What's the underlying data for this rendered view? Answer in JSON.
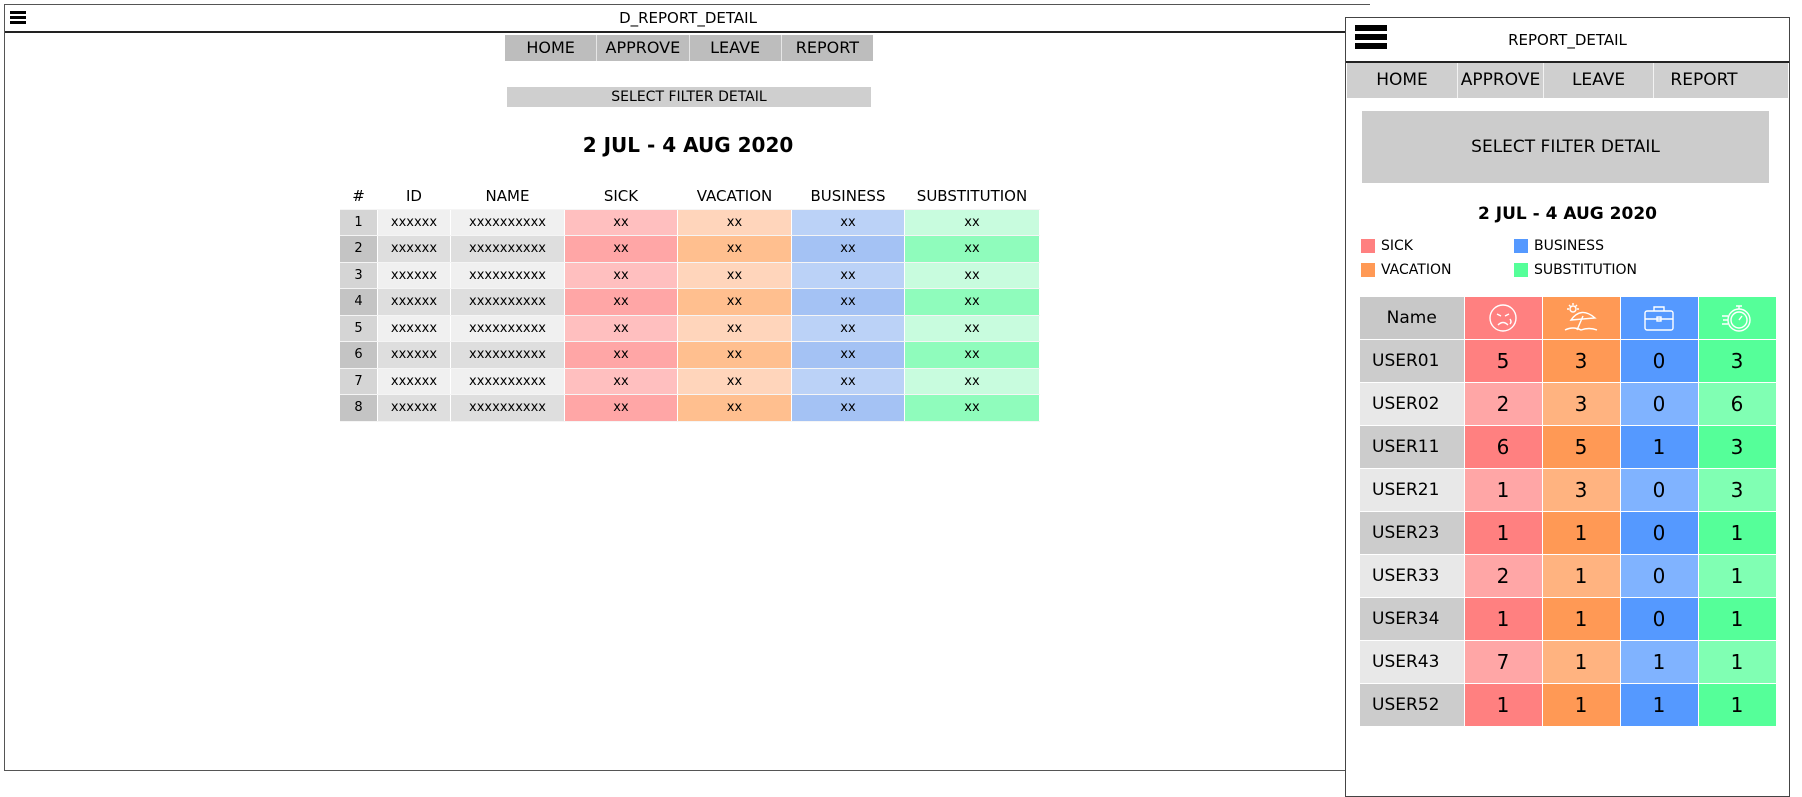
{
  "desktop": {
    "title": "D_REPORT_DETAIL",
    "nav": [
      "HOME",
      "APPROVE",
      "LEAVE",
      "REPORT"
    ],
    "filter_label": "SELECT FILTER DETAIL",
    "date_range": "2 JUL - 4 AUG 2020",
    "table": {
      "headers": [
        "#",
        "ID",
        "NAME",
        "SICK",
        "VACATION",
        "BUSINESS",
        "SUBSTITUTION"
      ],
      "rows": [
        [
          "1",
          "xxxxxx",
          "xxxxxxxxxx",
          "xx",
          "xx",
          "xx",
          "xx"
        ],
        [
          "2",
          "xxxxxx",
          "xxxxxxxxxx",
          "xx",
          "xx",
          "xx",
          "xx"
        ],
        [
          "3",
          "xxxxxx",
          "xxxxxxxxxx",
          "xx",
          "xx",
          "xx",
          "xx"
        ],
        [
          "4",
          "xxxxxx",
          "xxxxxxxxxx",
          "xx",
          "xx",
          "xx",
          "xx"
        ],
        [
          "5",
          "xxxxxx",
          "xxxxxxxxxx",
          "xx",
          "xx",
          "xx",
          "xx"
        ],
        [
          "6",
          "xxxxxx",
          "xxxxxxxxxx",
          "xx",
          "xx",
          "xx",
          "xx"
        ],
        [
          "7",
          "xxxxxx",
          "xxxxxxxxxx",
          "xx",
          "xx",
          "xx",
          "xx"
        ],
        [
          "8",
          "xxxxxx",
          "xxxxxxxxxx",
          "xx",
          "xx",
          "xx",
          "xx"
        ]
      ]
    }
  },
  "mobile": {
    "title": "REPORT_DETAIL",
    "nav": [
      "HOME",
      "APPROVE",
      "LEAVE",
      "REPORT"
    ],
    "filter_label": "SELECT FILTER DETAIL",
    "date_range": "2 JUL - 4 AUG 2020",
    "legend": [
      "SICK",
      "BUSINESS",
      "VACATION",
      "SUBSTITUTION"
    ],
    "table": {
      "name_header": "Name",
      "header_icons": [
        "sick-face-icon",
        "beach-umbrella-icon",
        "briefcase-icon",
        "stopwatch-icon"
      ],
      "rows": [
        [
          "USER01",
          "5",
          "3",
          "0",
          "3"
        ],
        [
          "USER02",
          "2",
          "3",
          "0",
          "6"
        ],
        [
          "USER11",
          "6",
          "5",
          "1",
          "3"
        ],
        [
          "USER21",
          "1",
          "3",
          "0",
          "3"
        ],
        [
          "USER23",
          "1",
          "1",
          "0",
          "1"
        ],
        [
          "USER33",
          "2",
          "1",
          "0",
          "1"
        ],
        [
          "USER34",
          "1",
          "1",
          "0",
          "1"
        ],
        [
          "USER43",
          "7",
          "1",
          "1",
          "1"
        ],
        [
          "USER52",
          "1",
          "1",
          "1",
          "1"
        ]
      ]
    }
  },
  "colors": {
    "sick": "#ff8080",
    "vacation": "#ff9955",
    "business": "#5599ff",
    "substitution": "#55ff99",
    "nav_bg": "#bdbdbd"
  }
}
